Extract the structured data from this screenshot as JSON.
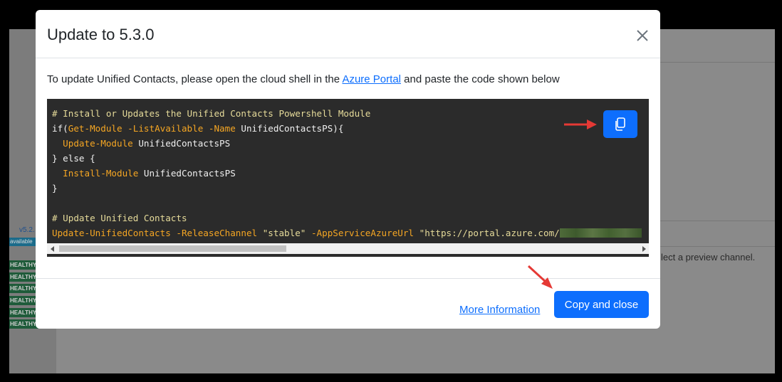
{
  "background": {
    "version": "v5.2.",
    "available": "available",
    "health_labels": [
      "HEALTHY",
      "HEALTHY",
      "HEALTHY",
      "HEALTHY",
      "HEALTHY",
      "HEALTHY"
    ],
    "hint_text": "lect a preview channel."
  },
  "modal": {
    "title": "Update to 5.3.0",
    "intro_before": "To update Unified Contacts, please open the cloud shell in the ",
    "intro_link": "Azure Portal",
    "intro_after": " and paste the code shown below",
    "code": {
      "line1": "# Install or Updates the Unified Contacts Powershell Module",
      "l2_a": "if(",
      "l2_cmd": "Get-Module -ListAvailable -Name",
      "l2_b": " UnifiedContactsPS){",
      "l3_cmd": "  Update-Module",
      "l3_b": " UnifiedContactsPS",
      "line4": "} else {",
      "l5_cmd": "  Install-Module",
      "l5_b": " UnifiedContactsPS",
      "line6": "}",
      "line8": "# Update Unified Contacts",
      "l9_cmd": "Update-UnifiedContacts -ReleaseChannel",
      "l9_str1": " \"stable\"",
      "l9_cmd2": " -AppServiceAzureUrl",
      "l9_str2": " \"https://portal.azure.com/"
    },
    "footer": {
      "more_info": "More Information",
      "copy_close": "Copy and close"
    }
  },
  "colors": {
    "primary": "#0d6efd",
    "code_bg": "#2b2b2b",
    "annotation_arrow": "#e53935"
  }
}
